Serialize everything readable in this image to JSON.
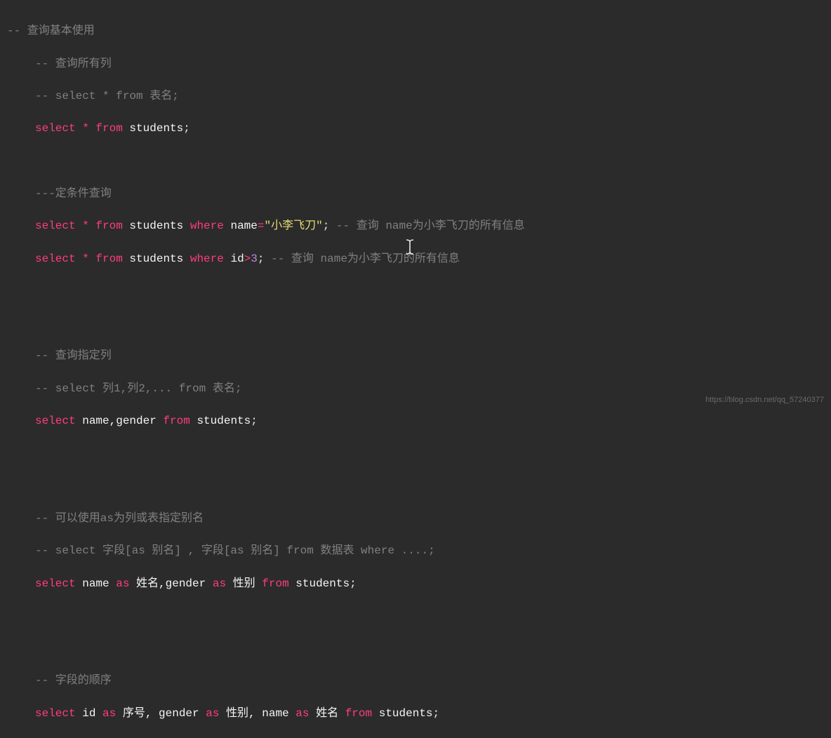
{
  "lines": {
    "l1": "-- 查询基本使用",
    "l2": "-- 查询所有列",
    "l3": "-- select * from 表名;",
    "l4_select": "select",
    "l4_star": " * ",
    "l4_from": "from",
    "l4_table": " students",
    "l4_semi": ";",
    "l5": "---定条件查询",
    "l6_select": "select",
    "l6_star": " * ",
    "l6_from": "from",
    "l6_table": " students ",
    "l6_where": "where",
    "l6_col": " name",
    "l6_eq": "=",
    "l6_str": "\"小李飞刀\"",
    "l6_semi": ";",
    "l6_cmt": " -- 查询 name为小李飞刀的所有信息",
    "l7_select": "select",
    "l7_star": " * ",
    "l7_from": "from",
    "l7_table": " students ",
    "l7_where": "where",
    "l7_col": " id",
    "l7_op": ">",
    "l7_num": "3",
    "l7_semi": ";",
    "l7_cmt": " -- 查询 name为小李飞刀的所有信息",
    "l8": "-- 查询指定列",
    "l9": "-- select 列1,列2,... from 表名;",
    "l10_select": "select",
    "l10_cols": " name,gender ",
    "l10_from": "from",
    "l10_table": " students",
    "l10_semi": ";",
    "l11": "-- 可以使用as为列或表指定别名",
    "l12": "-- select 字段[as 别名] , 字段[as 别名] from 数据表 where ....;",
    "l13_select": "select",
    "l13_c1": " name ",
    "l13_as1": "as",
    "l13_a1": " 姓名,gender ",
    "l13_as2": "as",
    "l13_a2": " 性别 ",
    "l13_from": "from",
    "l13_table": " students",
    "l13_semi": ";",
    "l14": "-- 字段的顺序",
    "l15_select": "select",
    "l15_c1": " id ",
    "l15_as1": "as",
    "l15_a1": " 序号, gender ",
    "l15_as2": "as",
    "l15_a2": " 性别, name ",
    "l15_as3": "as",
    "l15_a3": " 姓名 ",
    "l15_from": "from",
    "l15_table": " students",
    "l15_semi": ";"
  },
  "watermark": "https://blog.csdn.net/qq_57240377"
}
